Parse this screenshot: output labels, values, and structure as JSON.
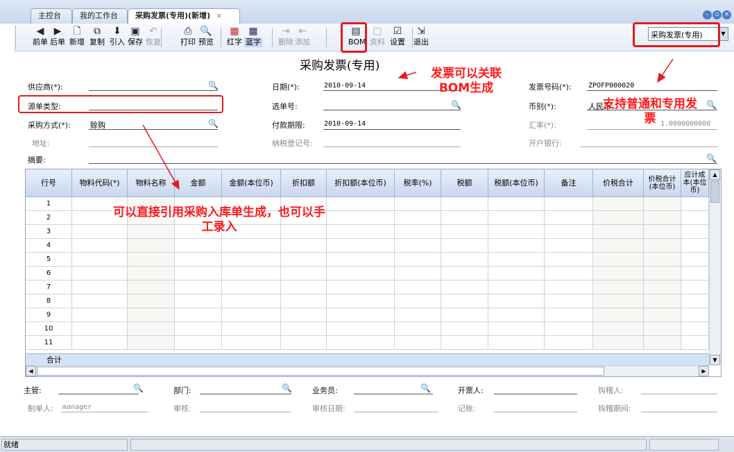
{
  "tabs": [
    {
      "label": "主控台"
    },
    {
      "label": "我的工作台"
    },
    {
      "label": "采购发票(专用)(新增)",
      "close": "×"
    }
  ],
  "toolbar": {
    "items": [
      {
        "label": "前单",
        "icon": "prev-arrow-icon",
        "glyph": "◀"
      },
      {
        "label": "后单",
        "icon": "next-arrow-icon",
        "glyph": "▶"
      },
      {
        "label": "新增",
        "icon": "new-doc-icon",
        "glyph": "🗋"
      },
      {
        "label": "复制",
        "icon": "copy-icon",
        "glyph": "⧉"
      },
      {
        "label": "引入",
        "icon": "import-icon",
        "glyph": "⬇"
      },
      {
        "label": "保存",
        "icon": "save-icon",
        "glyph": "▣"
      },
      {
        "label": "恢复",
        "icon": "undo-icon",
        "glyph": "↶"
      },
      {
        "label": "打印",
        "icon": "print-icon",
        "glyph": "⎙"
      },
      {
        "label": "预览",
        "icon": "preview-icon",
        "glyph": "🔍"
      },
      {
        "label": "红字",
        "icon": "red-grid-icon",
        "glyph": "▦"
      },
      {
        "label": "蓝字",
        "icon": "blue-grid-icon",
        "glyph": "▦"
      },
      {
        "label": "删除",
        "icon": "delete-row-icon",
        "glyph": "⇥"
      },
      {
        "label": "添加",
        "icon": "add-row-icon",
        "glyph": "⇤"
      },
      {
        "label": "BOM",
        "icon": "bom-icon",
        "glyph": "▤"
      },
      {
        "label": "资料",
        "icon": "data-icon",
        "glyph": "▢"
      },
      {
        "label": "设置",
        "icon": "settings-icon",
        "glyph": "☑"
      },
      {
        "label": "退出",
        "icon": "exit-icon",
        "glyph": "⇲"
      }
    ],
    "invoice_type": "采购发票(专用)"
  },
  "doc_title": "采购发票(专用)",
  "annotations": {
    "bom": "发票可以关联BOM生成",
    "type": "支持普通和专用发票",
    "grid": "可以直接引用采购入库单生成，也可以手工录入"
  },
  "header": {
    "supplier_label": "供应商(*):",
    "source_type_label": "源单类型:",
    "purchase_method_label": "采购方式(*):",
    "purchase_method_value": "赊购",
    "address_label": "地址:",
    "memo_label": "摘要:",
    "date_label": "日期(*):",
    "date_value": "2010-09-14",
    "select_doc_label": "选单号:",
    "pay_due_label": "付款期限:",
    "pay_due_value": "2010-09-14",
    "tax_reg_label": "纳税登记号:",
    "invoice_no_label": "发票号码(*):",
    "invoice_no_value": "ZPOFP000020",
    "currency_label": "币别(*):",
    "currency_value": "人民币",
    "rate_label": "汇率(*):",
    "rate_value": "1.0000000000",
    "bank_label": "开户银行:"
  },
  "grid": {
    "columns": [
      "行号",
      "物料代码(*)",
      "物料名称",
      "金额",
      "金额(本位币)",
      "折扣额",
      "折扣额(本位币)",
      "税率(%)",
      "税额",
      "税额(本位币)",
      "备注",
      "价税合计",
      "价税合计(本位币)",
      "应计成本(本位币)"
    ],
    "rows": [
      "1",
      "2",
      "3",
      "4",
      "5",
      "6",
      "7",
      "8",
      "9",
      "10",
      "11"
    ],
    "total_label": "合计"
  },
  "footer": {
    "supervisor_label": "主管:",
    "dept_label": "部门:",
    "salesman_label": "业务员:",
    "invoicer_label": "开票人:",
    "verifier_label": "钩稽人:",
    "maker_label": "制单人:",
    "maker_value": "manager",
    "auditor_label": "审核:",
    "audit_date_label": "审核日期:",
    "bookkeep_label": "记账:",
    "verify_period_label": "钩稽期间:"
  },
  "status": {
    "text": "就绪"
  },
  "colors": {
    "annotation": "#ff1a1a",
    "header_bg": "#c9d8ee",
    "total_row": "#d4e2f5"
  }
}
